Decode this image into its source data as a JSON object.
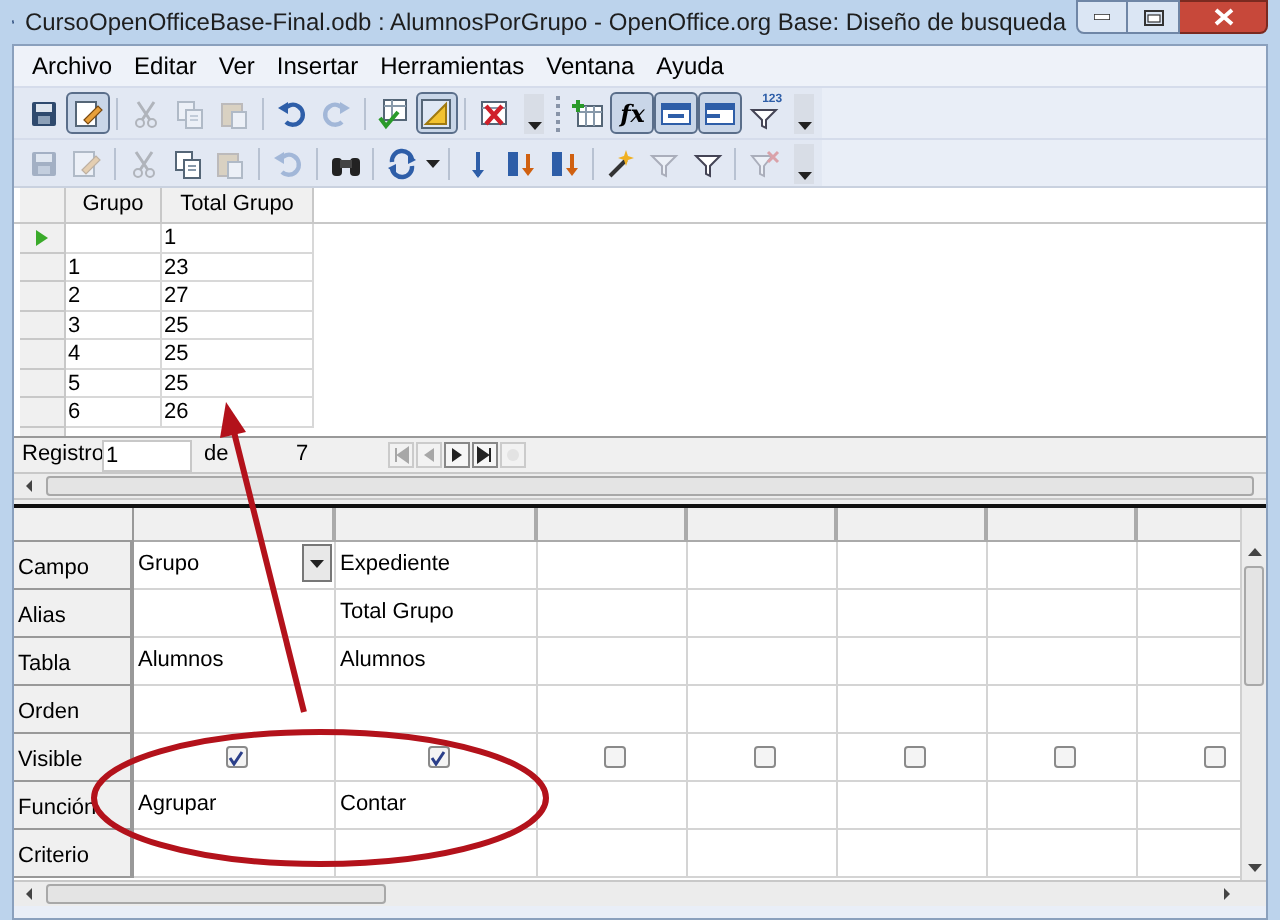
{
  "window": {
    "title": "CursoOpenOfficeBase-Final.odb : AlumnosPorGrupo - OpenOffice.org Base: Diseño de busqueda"
  },
  "menu": [
    "Archivo",
    "Editar",
    "Ver",
    "Insertar",
    "Herramientas",
    "Ventana",
    "Ayuda"
  ],
  "toolbar_1": [
    {
      "kind": "save",
      "pressed": false,
      "disabled": false
    },
    {
      "kind": "edit",
      "pressed": true,
      "disabled": false
    },
    {
      "kind": "sep"
    },
    {
      "kind": "cut",
      "pressed": false,
      "disabled": true
    },
    {
      "kind": "copy",
      "pressed": false,
      "disabled": true
    },
    {
      "kind": "paste",
      "pressed": false,
      "disabled": true
    },
    {
      "kind": "sep"
    },
    {
      "kind": "undo",
      "pressed": false,
      "disabled": false
    },
    {
      "kind": "redo",
      "pressed": false,
      "disabled": true
    },
    {
      "kind": "sep"
    },
    {
      "kind": "run",
      "pressed": false,
      "disabled": false
    },
    {
      "kind": "design",
      "pressed": true,
      "disabled": false
    },
    {
      "kind": "sep"
    },
    {
      "kind": "delete",
      "pressed": false,
      "disabled": false
    },
    {
      "kind": "more"
    },
    {
      "kind": "grip"
    },
    {
      "kind": "addtable",
      "pressed": false,
      "disabled": false
    },
    {
      "kind": "function",
      "label": "fx",
      "pressed": true,
      "disabled": false
    },
    {
      "kind": "alias",
      "pressed": true,
      "disabled": false
    },
    {
      "kind": "tablename",
      "pressed": true,
      "disabled": false
    },
    {
      "kind": "limit",
      "label": "123",
      "pressed": false,
      "disabled": false
    },
    {
      "kind": "more"
    }
  ],
  "toolbar_2": [
    {
      "kind": "save",
      "pressed": false,
      "disabled": true
    },
    {
      "kind": "edit",
      "pressed": false,
      "disabled": true
    },
    {
      "kind": "sep"
    },
    {
      "kind": "cut",
      "pressed": false,
      "disabled": true
    },
    {
      "kind": "copy",
      "pressed": false,
      "disabled": false
    },
    {
      "kind": "paste",
      "pressed": false,
      "disabled": true
    },
    {
      "kind": "sep"
    },
    {
      "kind": "undo",
      "pressed": false,
      "disabled": true
    },
    {
      "kind": "sep"
    },
    {
      "kind": "find",
      "pressed": false,
      "disabled": false
    },
    {
      "kind": "sep"
    },
    {
      "kind": "refresh",
      "pressed": false,
      "disabled": false
    },
    {
      "kind": "caret"
    },
    {
      "kind": "sep"
    },
    {
      "kind": "sortasc",
      "pressed": false,
      "disabled": false
    },
    {
      "kind": "sortup",
      "pressed": false,
      "disabled": false
    },
    {
      "kind": "sortdown",
      "pressed": false,
      "disabled": false
    },
    {
      "kind": "sep"
    },
    {
      "kind": "autofilter",
      "pressed": false,
      "disabled": false
    },
    {
      "kind": "stdfilter",
      "pressed": false,
      "disabled": true
    },
    {
      "kind": "filter",
      "pressed": false,
      "disabled": false
    },
    {
      "kind": "sep"
    },
    {
      "kind": "removefilter",
      "pressed": false,
      "disabled": true
    },
    {
      "kind": "more"
    }
  ],
  "results": {
    "columns": [
      "Grupo",
      "Total Grupo"
    ],
    "rows": [
      {
        "current": true,
        "total": "1"
      },
      {
        "current": false,
        "grupo": "1",
        "total": "23"
      },
      {
        "current": false,
        "grupo": "2",
        "total": "27"
      },
      {
        "current": false,
        "grupo": "3",
        "total": "25"
      },
      {
        "current": false,
        "grupo": "4",
        "total": "25"
      },
      {
        "current": false,
        "grupo": "5",
        "total": "25"
      },
      {
        "current": false,
        "grupo": "6",
        "total": "26"
      }
    ]
  },
  "record_bar": {
    "label": "Registro",
    "value": "1",
    "of": "de",
    "count": "7",
    "nav": [
      {
        "kind": "first",
        "disabled": true
      },
      {
        "kind": "prev",
        "disabled": true
      },
      {
        "kind": "next",
        "disabled": false
      },
      {
        "kind": "last",
        "disabled": false
      },
      {
        "kind": "new",
        "disabled": true
      }
    ]
  },
  "design_grid": {
    "rows": [
      {
        "label": "Campo",
        "kind": "field"
      },
      {
        "label": "Alias",
        "kind": "alias"
      },
      {
        "label": "Tabla",
        "kind": "table"
      },
      {
        "label": "Orden",
        "kind": "order"
      },
      {
        "label": "Visible",
        "kind": "visible"
      },
      {
        "label": "Función",
        "kind": "function"
      },
      {
        "label": "Criterio",
        "kind": "criteria"
      }
    ],
    "columns": [
      {
        "field": "Grupo",
        "table": "Alumnos",
        "visible": true,
        "function": "Agrupar",
        "dropdown": true
      },
      {
        "field": "Expediente",
        "alias": "Total Grupo",
        "table": "Alumnos",
        "visible": true,
        "function": "Contar",
        "dropdown": false
      },
      {
        "visible": false,
        "dropdown": false
      },
      {
        "visible": false,
        "dropdown": false
      },
      {
        "visible": false,
        "dropdown": false
      },
      {
        "visible": false,
        "dropdown": false
      },
      {
        "visible": false
      }
    ]
  }
}
